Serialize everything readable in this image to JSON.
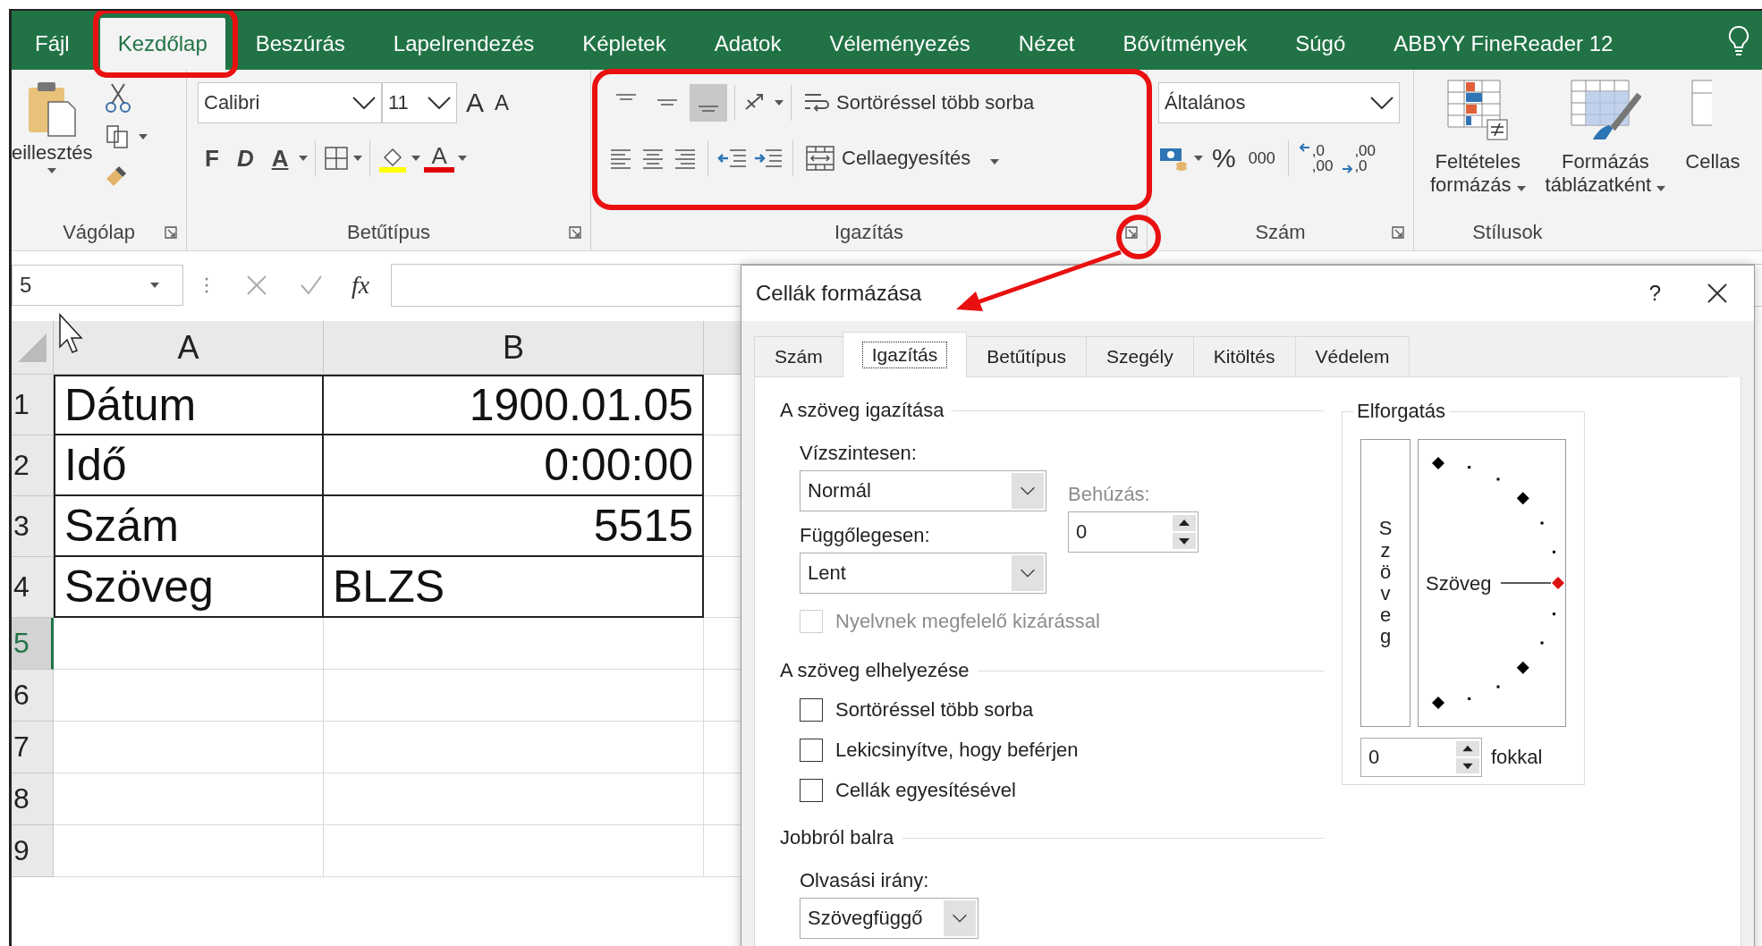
{
  "ribbon_tabs": [
    {
      "label": "Fájl",
      "selected": false
    },
    {
      "label": "Kezdőlap",
      "selected": true
    },
    {
      "label": "Beszúrás",
      "selected": false
    },
    {
      "label": "Lapelrendezés",
      "selected": false
    },
    {
      "label": "Képletek",
      "selected": false
    },
    {
      "label": "Adatok",
      "selected": false
    },
    {
      "label": "Véleményezés",
      "selected": false
    },
    {
      "label": "Nézet",
      "selected": false
    },
    {
      "label": "Bővítmények",
      "selected": false
    },
    {
      "label": "Súgó",
      "selected": false
    },
    {
      "label": "ABBYY FineReader 12",
      "selected": false
    }
  ],
  "ribbon": {
    "clipboard": {
      "paste_label": "eillesztés",
      "group_label": "Vágólap"
    },
    "font": {
      "font_name": "Calibri",
      "font_size": "11",
      "grow_label": "A",
      "shrink_label": "A",
      "bold_label": "F",
      "italic_label": "D",
      "underline_label": "A",
      "color_label": "A",
      "group_label": "Betűtípus"
    },
    "alignment": {
      "vertical_buttons": [
        {
          "kind": "top",
          "selected": false
        },
        {
          "kind": "middle",
          "selected": false
        },
        {
          "kind": "bottom",
          "selected": true
        }
      ],
      "wrap_label": "Sortöréssel több sorba",
      "merge_label": "Cellaegyesítés",
      "group_label": "Igazítás"
    },
    "number": {
      "format": "Általános",
      "percent_label": "%",
      "thousands_label": "000",
      "decimal_buttons": [
        {
          "kind": "increase",
          "top": ",0",
          "bottom": ",00"
        },
        {
          "kind": "decrease",
          "top": ",00",
          "bottom": ",0"
        }
      ],
      "group_label": "Szám"
    },
    "styles": {
      "conditional": [
        "Feltételes",
        "formázás"
      ],
      "table": [
        "Formázás",
        "táblázatként"
      ],
      "cell_styles": "Cellas",
      "group_label": "Stílusok"
    }
  },
  "formula_bar": {
    "name_box": "5",
    "function_label": "fx"
  },
  "sheet": {
    "columns": [
      "A",
      "B"
    ],
    "rows": [
      {
        "number": "1",
        "selected": false,
        "cells": [
          {
            "text": "Dátum",
            "kind": "text"
          },
          {
            "text": "1900.01.05",
            "kind": "number"
          }
        ]
      },
      {
        "number": "2",
        "selected": false,
        "cells": [
          {
            "text": "Idő",
            "kind": "text"
          },
          {
            "text": "0:00:00",
            "kind": "number"
          }
        ]
      },
      {
        "number": "3",
        "selected": false,
        "cells": [
          {
            "text": "Szám",
            "kind": "text"
          },
          {
            "text": "5515",
            "kind": "number"
          }
        ]
      },
      {
        "number": "4",
        "selected": false,
        "cells": [
          {
            "text": "Szöveg",
            "kind": "text"
          },
          {
            "text": "BLZS",
            "kind": "text"
          }
        ]
      },
      {
        "number": "5",
        "selected": true
      },
      {
        "number": "6",
        "selected": false
      },
      {
        "number": "7",
        "selected": false
      },
      {
        "number": "8",
        "selected": false
      },
      {
        "number": "9",
        "selected": false
      }
    ]
  },
  "dialog": {
    "title": "Cellák formázása",
    "help": "?",
    "tabs": [
      {
        "label": "Szám",
        "selected": false
      },
      {
        "label": "Igazítás",
        "selected": true
      },
      {
        "label": "Betűtípus",
        "selected": false
      },
      {
        "label": "Szegély",
        "selected": false
      },
      {
        "label": "Kitöltés",
        "selected": false
      },
      {
        "label": "Védelem",
        "selected": false
      }
    ],
    "text_alignment": {
      "title": "A szöveg igazítása",
      "horizontal_label": "Vízszintesen:",
      "horizontal_value": "Normál",
      "vertical_label": "Függőlegesen:",
      "vertical_value": "Lent",
      "indent_label": "Behúzás:",
      "indent_value": "0",
      "justify_distributed": {
        "label": "Nyelvnek megfelelő kizárással",
        "checked": false,
        "disabled": true
      }
    },
    "text_control": {
      "title": "A szöveg elhelyezése",
      "options": [
        {
          "label": "Sortöréssel több sorba",
          "checked": false
        },
        {
          "label": "Lekicsinyítve, hogy beférjen",
          "checked": false
        },
        {
          "label": "Cellák egyesítésével",
          "checked": false
        }
      ]
    },
    "right_to_left": {
      "title": "Jobbról balra",
      "direction_label": "Olvasási irány:",
      "direction_value": "Szövegfüggő"
    },
    "orientation": {
      "title": "Elforgatás",
      "vertical_text": "Szöveg",
      "dial_text": "Szöveg",
      "degrees_value": "0",
      "degrees_label": "fokkal"
    }
  }
}
